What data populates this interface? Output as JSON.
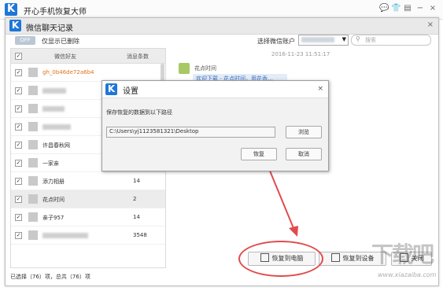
{
  "app": {
    "title": "开心手机恢复大师",
    "logo_letter": "K"
  },
  "window_controls": {
    "chat": "💬",
    "skin": "👕",
    "menu": "▤",
    "minimize": "−",
    "close": "×"
  },
  "dialog": {
    "title": "微信聊天记录",
    "logo_letter": "K",
    "close": "×"
  },
  "filter": {
    "toggle_text": "OFF",
    "toggle_label": "仅显示已删除",
    "account_label": "选择微信账户",
    "search_placeholder": "搜索"
  },
  "list": {
    "header_friend": "微信好友",
    "header_count": "消息条数",
    "rows": [
      {
        "name": "gh_0b46de72a6b4",
        "count": "",
        "highlight": true,
        "blurred": false
      },
      {
        "name": "",
        "count": "",
        "highlight": false,
        "blurred": true
      },
      {
        "name": "",
        "count": "",
        "highlight": false,
        "blurred": true
      },
      {
        "name": "",
        "count": "",
        "highlight": false,
        "blurred": true
      },
      {
        "name": "许昌春秋网",
        "count": "",
        "highlight": false,
        "blurred": false
      },
      {
        "name": "一家亲",
        "count": "",
        "highlight": false,
        "blurred": false
      },
      {
        "name": "添力相册",
        "count": "14",
        "highlight": false,
        "blurred": false
      },
      {
        "name": "花点时间",
        "count": "2",
        "highlight": false,
        "blurred": false,
        "selected": true
      },
      {
        "name": "亲子957",
        "count": "14",
        "highlight": false,
        "blurred": false
      },
      {
        "name": "",
        "count": "3548",
        "highlight": false,
        "blurred": true
      }
    ]
  },
  "chat": {
    "timestamp": "2016-11-23 11:51:17",
    "sender": "花点时间",
    "message": "欢迎下载 - 花点时间，用花香…"
  },
  "status_bar": {
    "selection_text": "已选择（76）项，总共（76）项"
  },
  "buttons": {
    "restore_to_pc": "恢复到电脑",
    "restore_to_device": "恢复到设备",
    "close": "关闭"
  },
  "settings_dialog": {
    "title": "设置",
    "logo_letter": "K",
    "close": "×",
    "label": "保存恢复的数据到以下路径",
    "path": "C:\\Users\\yj1123581321\\Desktop",
    "browse": "浏览",
    "restore": "恢复",
    "cancel": "取消"
  },
  "watermark": {
    "text": "下载吧",
    "url": "www.xiazaiba.com"
  },
  "colors": {
    "accent": "#1e77d8",
    "annotation_red": "#e24b4b",
    "highlight_name": "#e2721a"
  }
}
